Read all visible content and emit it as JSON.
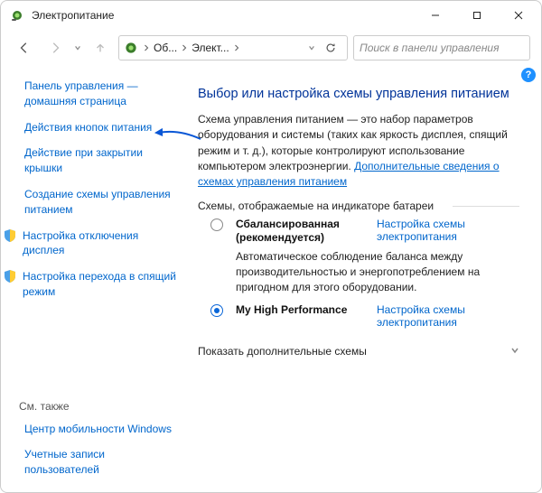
{
  "window": {
    "title": "Электропитание"
  },
  "toolbar": {
    "breadcrumb": {
      "seg1": "Об...",
      "seg2": "Элект..."
    },
    "search_placeholder": "Поиск в панели управления"
  },
  "sidebar": {
    "home": "Панель управления — домашняя страница",
    "items": [
      "Действия кнопок питания",
      "Действие при закрытии крышки",
      "Создание схемы управления питанием",
      "Настройка отключения дисплея",
      "Настройка перехода в спящий режим"
    ],
    "seealso": {
      "header": "См. также",
      "links": [
        "Центр мобильности Windows",
        "Учетные записи пользователей"
      ]
    }
  },
  "main": {
    "title": "Выбор или настройка схемы управления питанием",
    "desc_pre": "Схема управления питанием — это набор параметров оборудования и системы (таких как яркость дисплея, спящий режим и т. д.), которые контролируют использование компьютером электроэнергии. ",
    "desc_link": "Дополнительные сведения о схемах управления питанием",
    "section_label": "Схемы, отображаемые на индикаторе батареи",
    "plans": [
      {
        "name": "Сбалансированная (рекомендуется)",
        "action": "Настройка схемы электропитания",
        "desc": "Автоматическое соблюдение баланса между производительностью и энергопотреблением на пригодном для этого оборудовании.",
        "selected": false
      },
      {
        "name": "My High Performance",
        "action": "Настройка схемы электропитания",
        "desc": "",
        "selected": true
      }
    ],
    "show_more": "Показать дополнительные схемы",
    "help_badge": "?"
  }
}
